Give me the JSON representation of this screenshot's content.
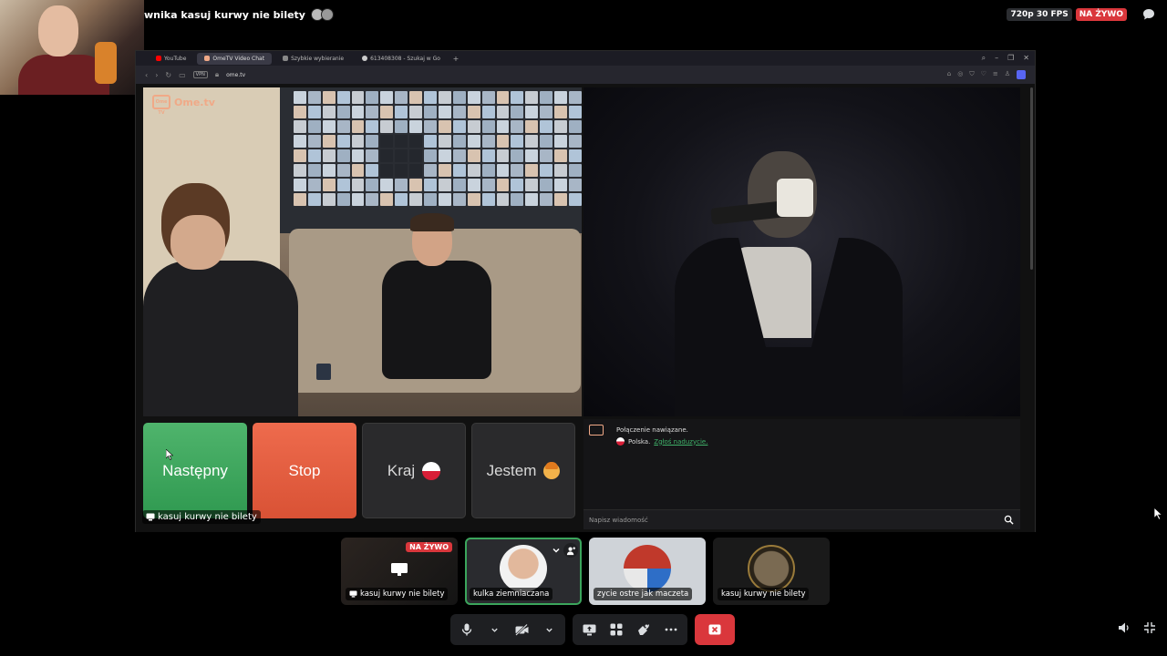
{
  "stream": {
    "title": "wnika kasuj kurwy nie bilety",
    "quality": "720p 30 FPS",
    "live_badge": "NA ŻYWO"
  },
  "browser": {
    "tabs": [
      {
        "label": "YouTube",
        "color": "#ff0000"
      },
      {
        "label": "OmeTV Video Chat",
        "color": "#f0a987",
        "active": true
      },
      {
        "label": "Szybkie wybieranie",
        "color": "#888888"
      },
      {
        "label": "613408308 - Szukaj w Go",
        "color": "#cccccc"
      }
    ],
    "vpn_label": "VPN",
    "url": "ome.tv"
  },
  "ometv": {
    "logo_text": "Ome.tv",
    "logo_box_text": "Ome TV",
    "buttons": {
      "next": "Następny",
      "stop": "Stop",
      "country": "Kraj",
      "gender": "Jestem"
    },
    "chat": {
      "connected": "Połączenie nawiązane.",
      "country": "Polska.",
      "report": "Zgłoś naduzycie.",
      "input_placeholder": "Napisz wiadomość"
    }
  },
  "stream_overlay_label": "kasuj kurwy nie bilety",
  "tiles": [
    {
      "label": "kasuj kurwy nie bilety",
      "live": "NA ŻYWO",
      "type": "stream"
    },
    {
      "label": "kulka ziemniaczana",
      "type": "user",
      "selected": true
    },
    {
      "label": "zycie ostre jak maczeta",
      "type": "user"
    },
    {
      "label": "kasuj kurwy nie bilety",
      "type": "user"
    }
  ],
  "colors": {
    "green": "#3ba55c",
    "red": "#da373c",
    "ometv_orange": "#f0a987",
    "next_green": "#3f9f5c",
    "stop_orange": "#e2593b"
  }
}
